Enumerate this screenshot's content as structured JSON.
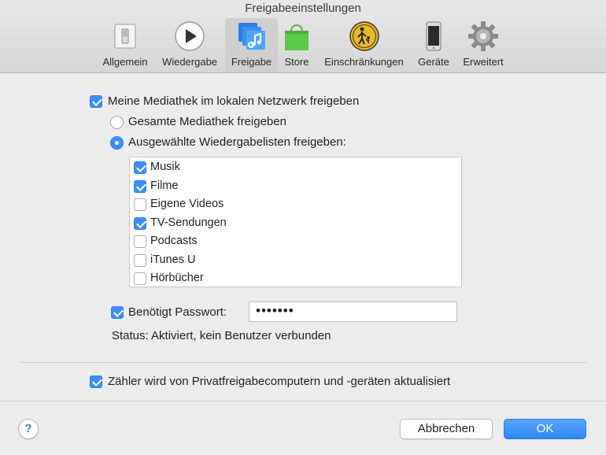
{
  "window": {
    "title": "Freigabeeinstellungen"
  },
  "toolbar": {
    "items": [
      {
        "label": "Allgemein",
        "icon": "general-switch-icon"
      },
      {
        "label": "Wiedergabe",
        "icon": "play-icon"
      },
      {
        "label": "Freigabe",
        "icon": "sharing-music-icon",
        "active": true
      },
      {
        "label": "Store",
        "icon": "shopping-bag-icon"
      },
      {
        "label": "Einschränkungen",
        "icon": "parental-restrictions-icon"
      },
      {
        "label": "Geräte",
        "icon": "iphone-icon"
      },
      {
        "label": "Erweitert",
        "icon": "gear-icon"
      }
    ]
  },
  "sharing": {
    "share_library_label": "Meine Mediathek im lokalen Netzwerk freigeben",
    "share_library_checked": true,
    "share_all_label": "Gesamte Mediathek freigeben",
    "share_selected_label": "Ausgewählte Wiedergabelisten freigeben:",
    "selected_mode": "selected",
    "playlists": [
      {
        "label": "Musik",
        "checked": true
      },
      {
        "label": "Filme",
        "checked": true
      },
      {
        "label": "Eigene Videos",
        "checked": false
      },
      {
        "label": "TV-Sendungen",
        "checked": true
      },
      {
        "label": "Podcasts",
        "checked": false
      },
      {
        "label": "iTunes U",
        "checked": false
      },
      {
        "label": "Hörbücher",
        "checked": false
      }
    ],
    "password_label": "Benötigt Passwort:",
    "password_checked": true,
    "password_value": "•••••••",
    "status_text": "Status: Aktiviert, kein Benutzer verbunden"
  },
  "counter": {
    "label": "Zähler wird von Privatfreigabecomputern und -geräten aktualisiert",
    "checked": true
  },
  "footer": {
    "help_label": "?",
    "cancel_label": "Abbrechen",
    "ok_label": "OK"
  },
  "colors": {
    "accent": "#3e8ef7",
    "window_bg": "#ececec"
  }
}
